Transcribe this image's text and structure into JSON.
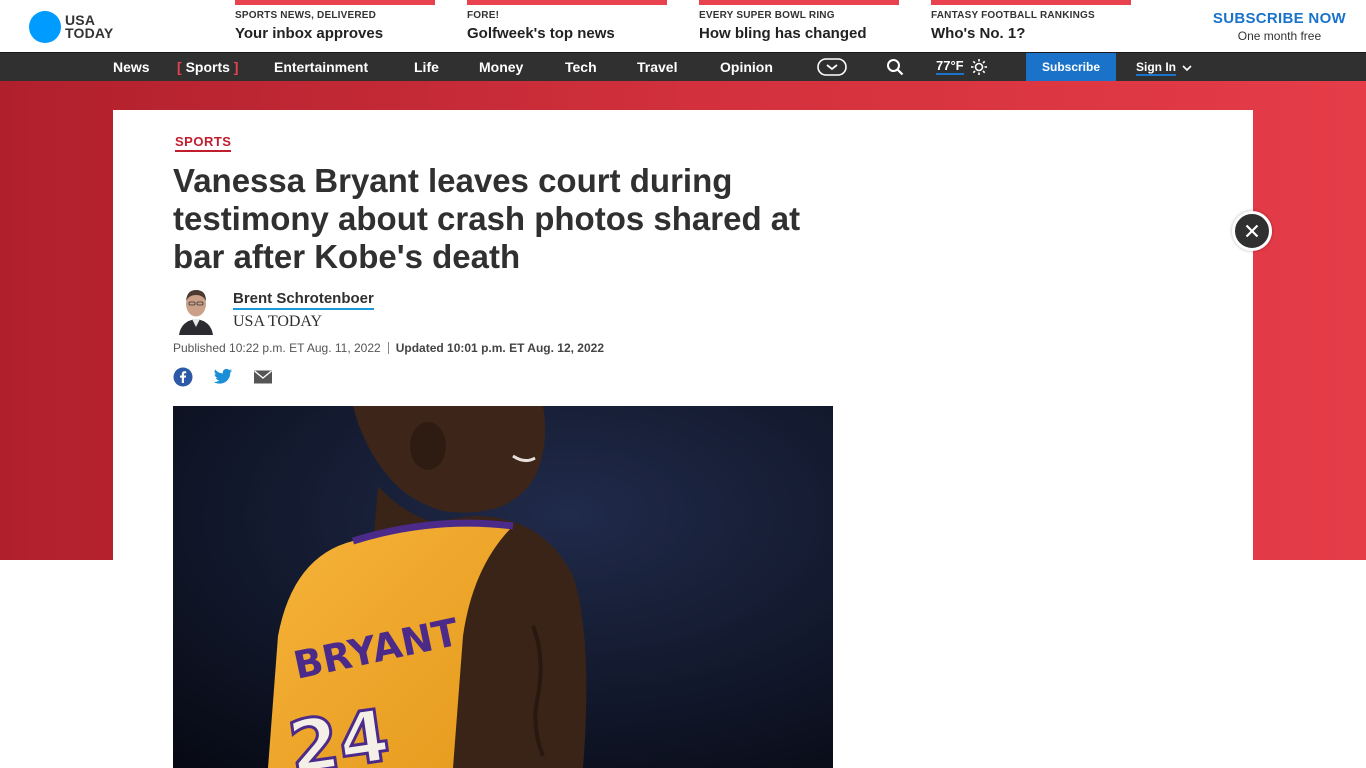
{
  "brand": {
    "logo_line1": "USA",
    "logo_line2": "TODAY"
  },
  "promos": [
    {
      "kicker": "SPORTS NEWS, DELIVERED",
      "headline": "Your inbox approves"
    },
    {
      "kicker": "FORE!",
      "headline": "Golfweek's top news"
    },
    {
      "kicker": "EVERY SUPER BOWL RING",
      "headline": "How bling has changed"
    },
    {
      "kicker": "FANTASY FOOTBALL RANKINGS",
      "headline": "Who's No. 1?"
    }
  ],
  "subscribe_promo": {
    "title": "SUBSCRIBE NOW",
    "subtitle": "One month free"
  },
  "nav": {
    "items": [
      "News",
      "Sports",
      "Entertainment",
      "Life",
      "Money",
      "Tech",
      "Travel",
      "Opinion"
    ],
    "active": "Sports",
    "weather": "77°F",
    "subscribe": "Subscribe",
    "sign_in": "Sign In"
  },
  "article": {
    "section": "SPORTS",
    "title": "Vanessa Bryant leaves court during testimony about crash photos shared at bar after Kobe's death",
    "author": "Brent Schrotenboer",
    "org": "USA TODAY",
    "published": "Published 10:22 p.m. ET Aug. 11, 2022",
    "updated": "Updated 10:01 p.m. ET Aug. 12, 2022"
  },
  "colors": {
    "accent_red": "#e8424e",
    "brand_blue": "#009bff",
    "link_blue": "#1a73c9",
    "nav_bg": "#303030"
  },
  "icons": [
    "facebook-icon",
    "twitter-icon",
    "email-icon",
    "search-icon",
    "sun-icon",
    "chevron-down-icon",
    "close-icon",
    "apps-icon"
  ]
}
